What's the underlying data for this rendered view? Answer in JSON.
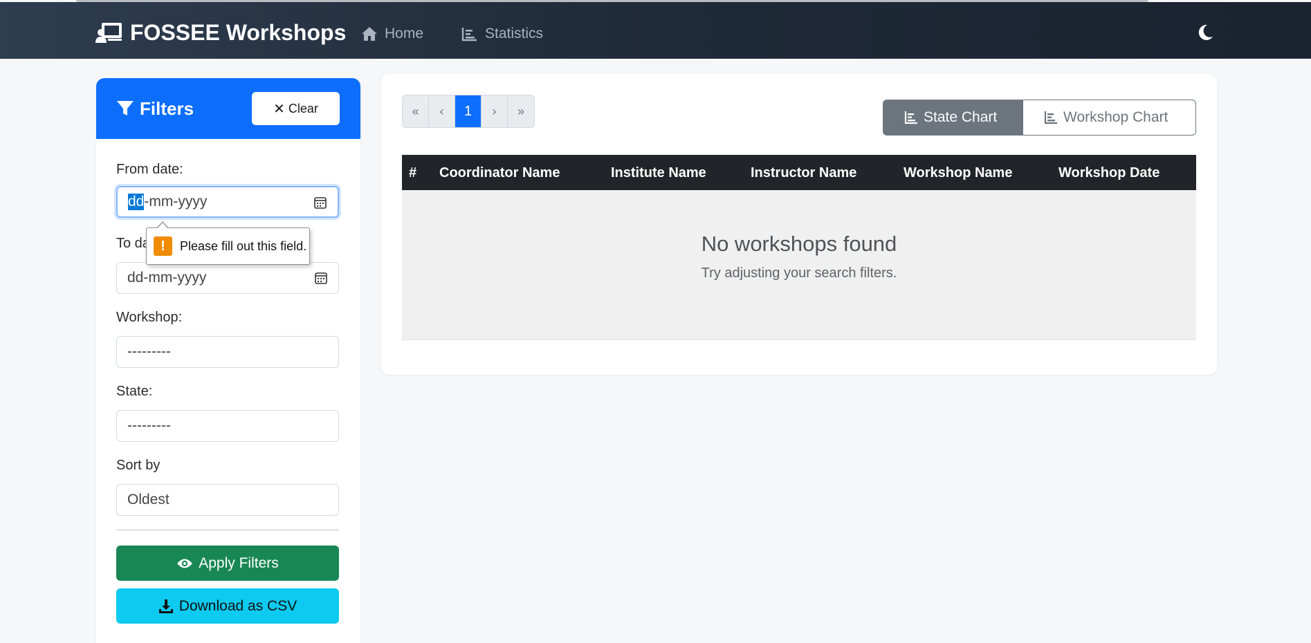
{
  "navbar": {
    "brand": "FOSSEE Workshops",
    "links": [
      {
        "label": "Home",
        "icon": "home-icon"
      },
      {
        "label": "Statistics",
        "icon": "chart-icon"
      }
    ],
    "theme_icon": "moon-icon"
  },
  "filters": {
    "title": "Filters",
    "clear_label": "Clear",
    "from_label": "From date:",
    "from_value_selected": "dd",
    "from_value_rest": "-mm-yyyy",
    "to_label": "To date:",
    "to_value": "dd-mm-yyyy",
    "workshop_label": "Workshop:",
    "workshop_value": "---------",
    "state_label": "State:",
    "state_value": "---------",
    "sort_label": "Sort by",
    "sort_value": "Oldest",
    "apply_label": "Apply Filters",
    "csv_label": "Download as CSV"
  },
  "tooltip": {
    "icon": "!",
    "text": "Please fill out this field."
  },
  "pagination": {
    "first": "«",
    "prev": "‹",
    "current": "1",
    "next": "›",
    "last": "»"
  },
  "charts": {
    "state_label": "State Chart",
    "workshop_label": "Workshop Chart"
  },
  "table": {
    "columns": [
      "#",
      "Coordinator Name",
      "Institute Name",
      "Instructor Name",
      "Workshop Name",
      "Workshop Date"
    ],
    "empty_title": "No workshops found",
    "empty_subtitle": "Try adjusting your search filters."
  },
  "colors": {
    "primary": "#0d6efd",
    "success": "#198754",
    "info": "#0dcaf0",
    "secondary": "#6c757d",
    "dark": "#212529"
  }
}
